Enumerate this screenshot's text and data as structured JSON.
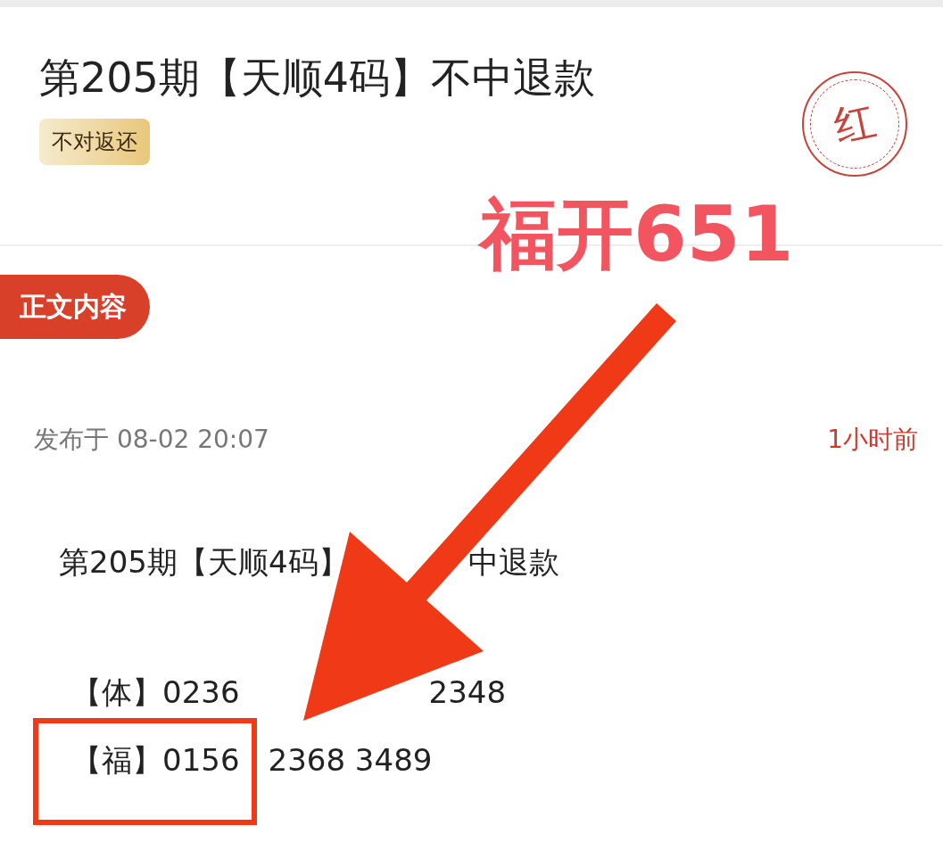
{
  "title": "第205期【天顺4码】不中退款",
  "badge": "不对返还",
  "stamp": "红",
  "section_tab": "正文内容",
  "published": "发布于 08-02 20:07",
  "relative_time": "1小时前",
  "body": {
    "heading_parts": [
      "第205期【天顺4码】",
      "中退款"
    ],
    "lines": [
      {
        "parts": [
          "【体】0236",
          "2348"
        ]
      },
      {
        "parts": [
          "【福】0156",
          "2368 3489"
        ]
      }
    ]
  },
  "annotation": {
    "text": "福开651"
  }
}
